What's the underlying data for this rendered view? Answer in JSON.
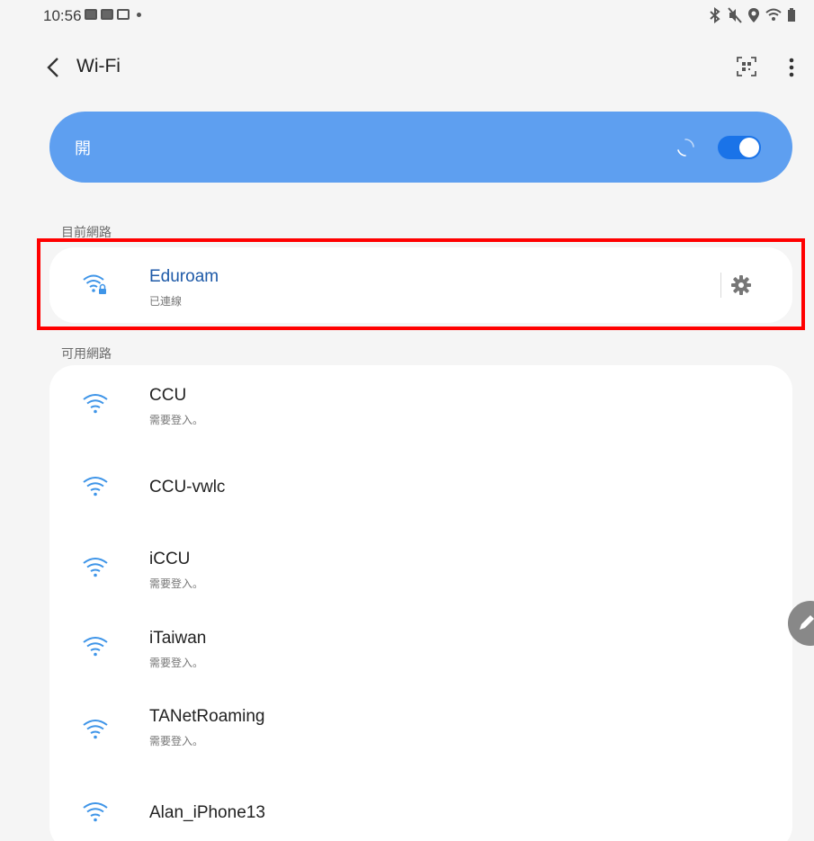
{
  "status_bar": {
    "time": "10:56"
  },
  "toolbar": {
    "title": "Wi-Fi"
  },
  "master_switch": {
    "label": "開",
    "state": "on"
  },
  "current_section": {
    "label": "目前網路"
  },
  "current_network": {
    "name": "Eduroam",
    "status": "已連線",
    "icon": "wifi-lock-icon"
  },
  "available_section": {
    "label": "可用網路"
  },
  "available_networks": [
    {
      "name": "CCU",
      "status": "需要登入。"
    },
    {
      "name": "CCU-vwlc",
      "status": ""
    },
    {
      "name": "iCCU",
      "status": "需要登入。"
    },
    {
      "name": "iTaiwan",
      "status": "需要登入。"
    },
    {
      "name": "TANetRoaming",
      "status": "需要登入。"
    },
    {
      "name": "Alan_iPhone13",
      "status": ""
    }
  ],
  "colors": {
    "accent": "#5e9ff0",
    "toggle_on": "#1a73e8",
    "wifi_icon": "#3f95e8",
    "highlight": "#ff0000"
  }
}
